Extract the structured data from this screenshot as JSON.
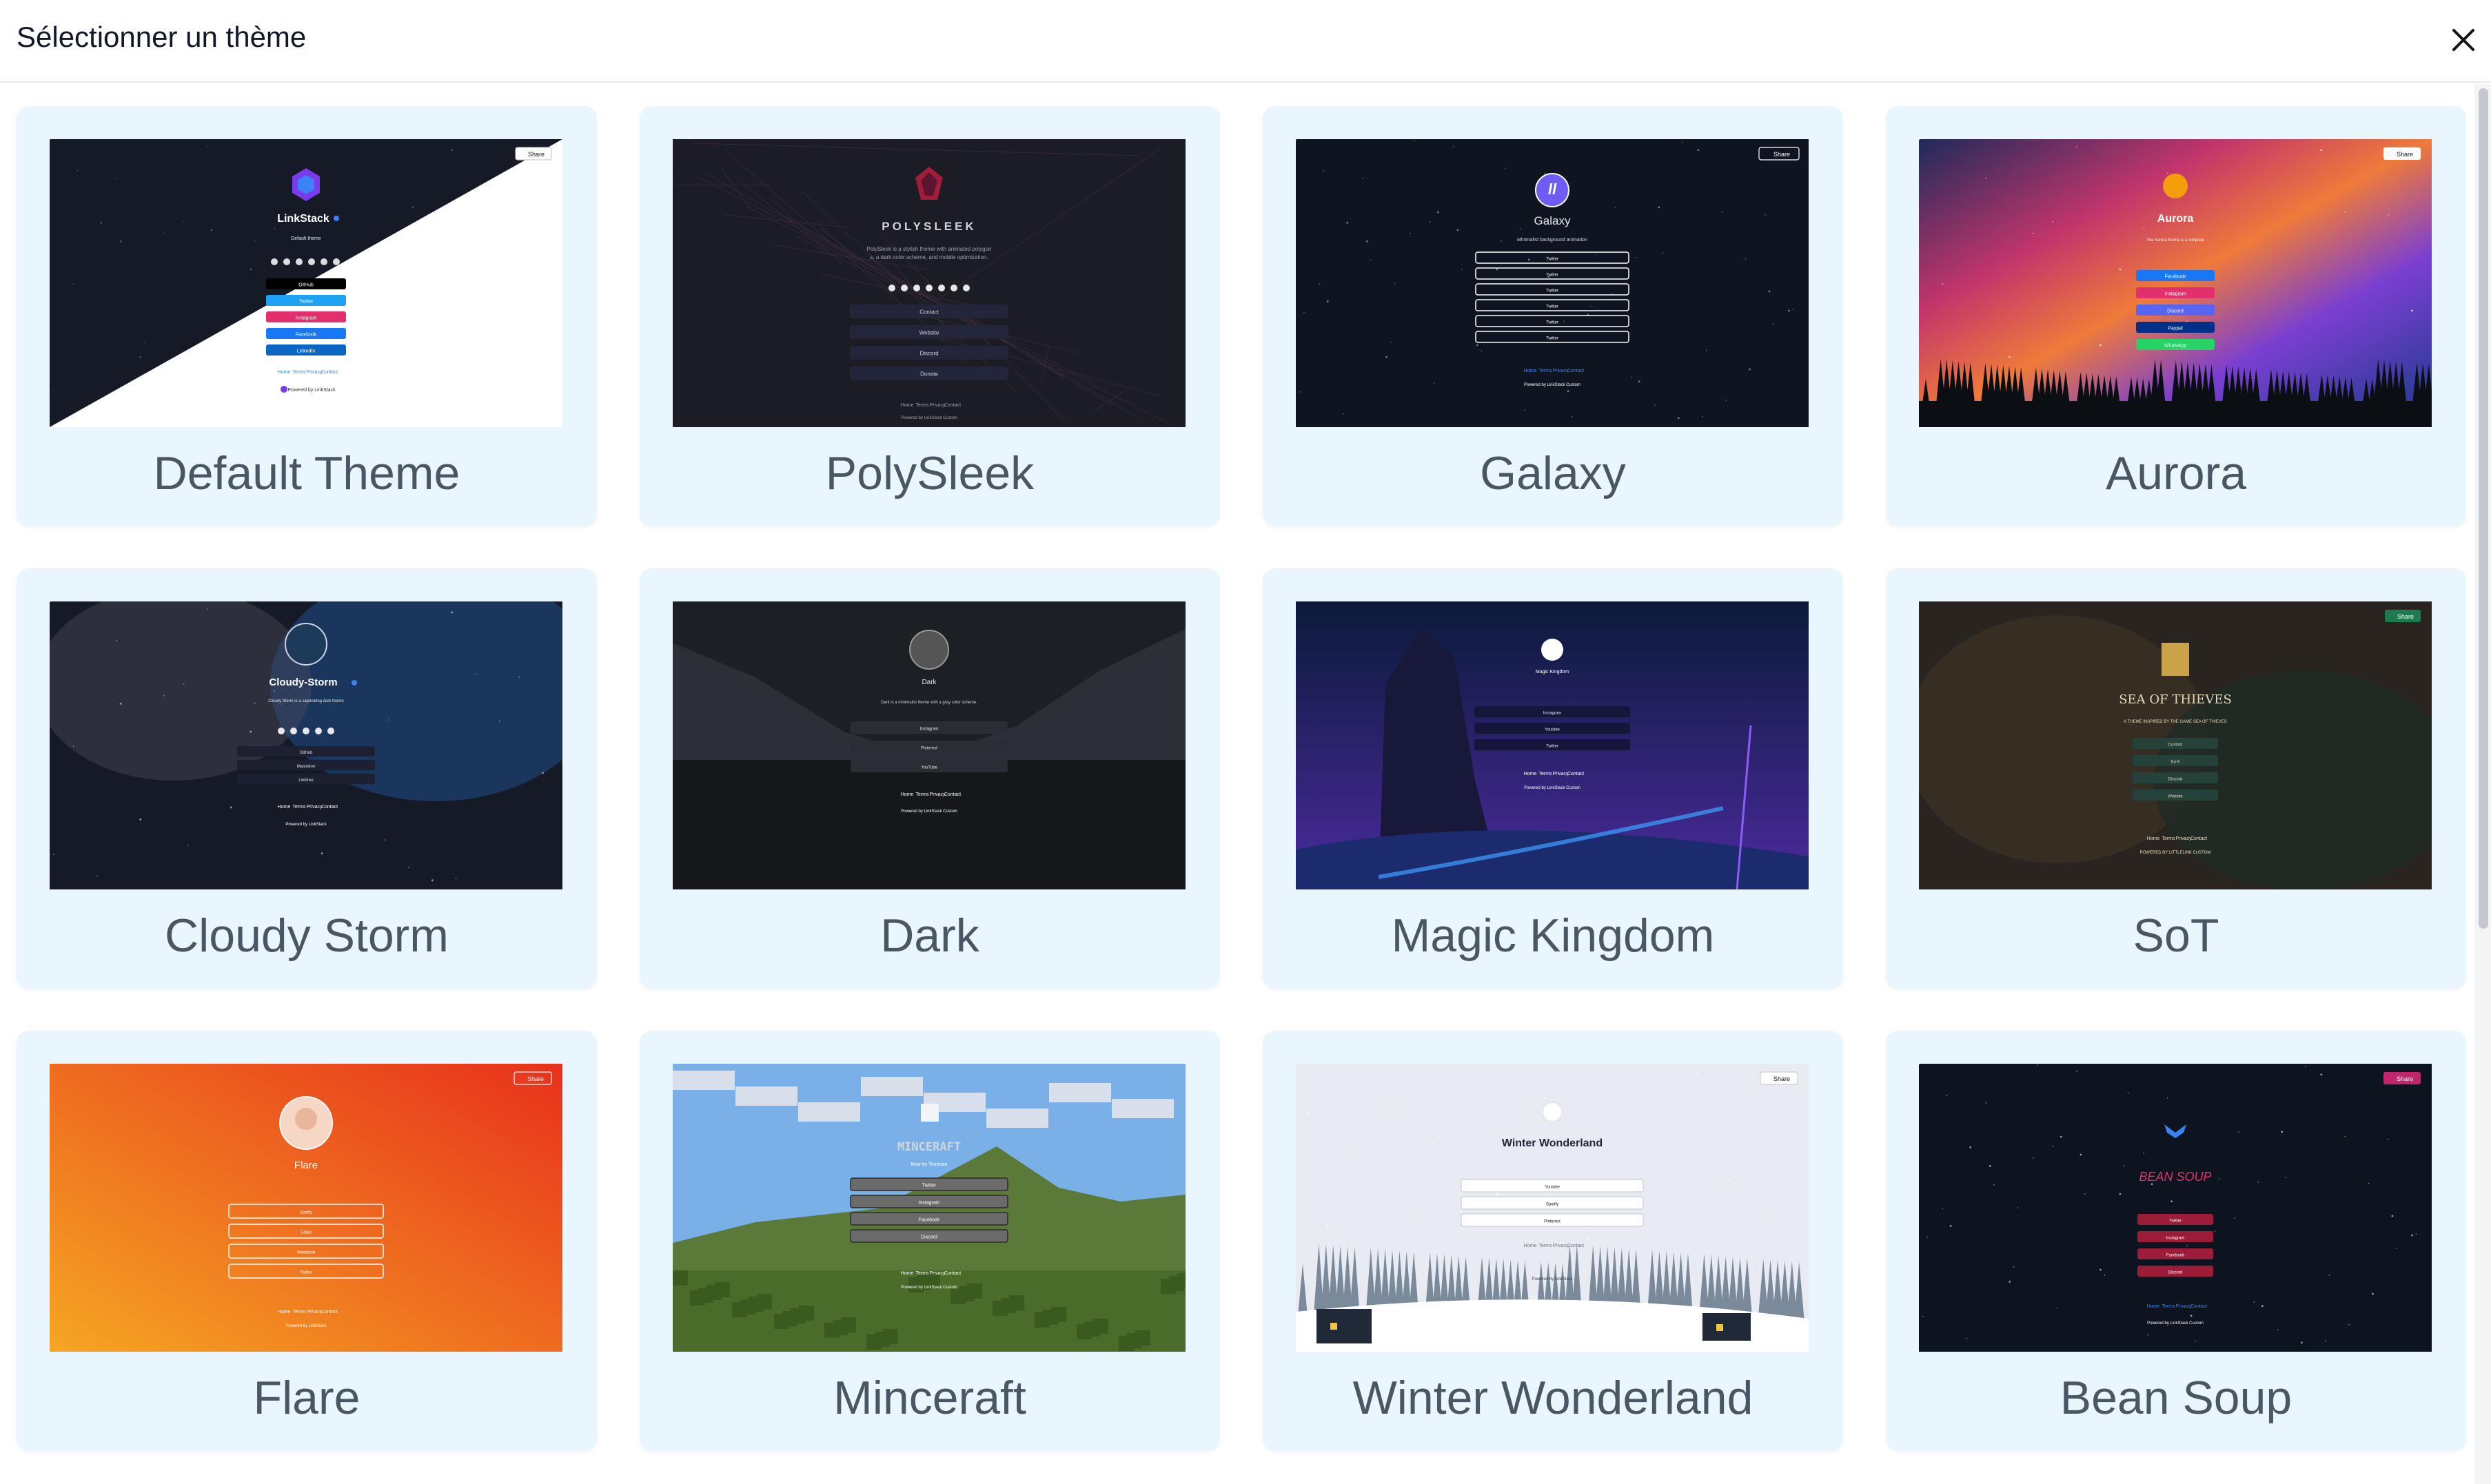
{
  "modal": {
    "title": "Sélectionner un thème",
    "close_icon": "close-icon"
  },
  "themes": [
    {
      "name": "Default Theme",
      "preview": {
        "profile": "LinkStack",
        "tagline": "Default theme",
        "share": "Share",
        "links": [
          "GitHub",
          "Twitter",
          "Instagram",
          "Facebook",
          "LinkedIn"
        ],
        "footer": "Powered by LinkStack"
      }
    },
    {
      "name": "PolySleek",
      "preview": {
        "profile": "POLYSLEEK",
        "tagline": "PolySleek is a stylish theme with animated polygons, a dark color scheme, and mobile optimization.",
        "links": [
          "Contact",
          "Website",
          "Discord",
          "Donate"
        ],
        "footer": "Powered by LinkStack Custom"
      }
    },
    {
      "name": "Galaxy",
      "preview": {
        "profile": "Galaxy",
        "tagline": "Minimalist background animation",
        "share": "Share",
        "links": [
          "Twitter",
          "Twitter",
          "Twitter",
          "Twitter",
          "Twitter",
          "Twitter"
        ],
        "footer": "Powered by LinkStack Custom"
      }
    },
    {
      "name": "Aurora",
      "preview": {
        "profile": "Aurora",
        "tagline": "The Aurora theme is a template",
        "share": "Share",
        "links": [
          "Facebook",
          "Instagram",
          "Discord",
          "Paypal",
          "WhatsApp"
        ]
      }
    },
    {
      "name": "Cloudy Storm",
      "preview": {
        "profile": "Cloudy-Storm",
        "tagline": "Cloudy Storm is a captivating dark theme",
        "links": [
          "GitHub",
          "Mastodon",
          "Linktree"
        ],
        "footer": "Powered by LinkStack"
      }
    },
    {
      "name": "Dark",
      "preview": {
        "profile": "Dark",
        "tagline": "Dark is a minimalist theme with a gray color scheme.",
        "links": [
          "Instagram",
          "Pinterest",
          "YouTube"
        ],
        "footer": "Powered by LinkStack Custom"
      }
    },
    {
      "name": "Magic Kingdom",
      "preview": {
        "profile": "Magic Kingdom",
        "links": [
          "Instagram",
          "Youtube",
          "Twitter"
        ],
        "footer": "Powered by LinkStack Custom"
      }
    },
    {
      "name": "SoT",
      "preview": {
        "profile": "SEA OF THIEVES",
        "tagline": "A THEME INSPIRED BY THE GAME SEA OF THIEVES",
        "share": "Share",
        "links": [
          "Custom",
          "Ko-fi",
          "Discord",
          "Website"
        ],
        "footer": "POWERED BY LITTLELINK CUSTOM"
      }
    },
    {
      "name": "Flare",
      "preview": {
        "profile": "Flare",
        "share": "Share",
        "links": [
          "Spotify",
          "Gitlab",
          "Mastodon",
          "Twitter"
        ],
        "footer": "Powered by LinkStack"
      }
    },
    {
      "name": "Minceraft",
      "preview": {
        "profile": "MINCERAFT",
        "tagline": "Now try Terrarian",
        "links": [
          "Twitter",
          "Instagram",
          "Facebook",
          "Discord"
        ],
        "footer": "Powered by LinkStack Custom"
      }
    },
    {
      "name": "Winter Wonderland",
      "preview": {
        "profile": "Winter Wonderland",
        "share": "Share",
        "links": [
          "Youtube",
          "Spotify",
          "Pinterest"
        ],
        "footer": "Powered by LinkStack"
      }
    },
    {
      "name": "Bean Soup",
      "preview": {
        "profile": "BEAN SOUP",
        "share": "Share",
        "links": [
          "Twitter",
          "Instagram",
          "Facebook",
          "Discord"
        ],
        "footer": "Powered by LinkStack Custom"
      }
    }
  ],
  "colors": {
    "card_bg": "#e9f6fd",
    "label": "#4b5563",
    "title": "#111827"
  }
}
